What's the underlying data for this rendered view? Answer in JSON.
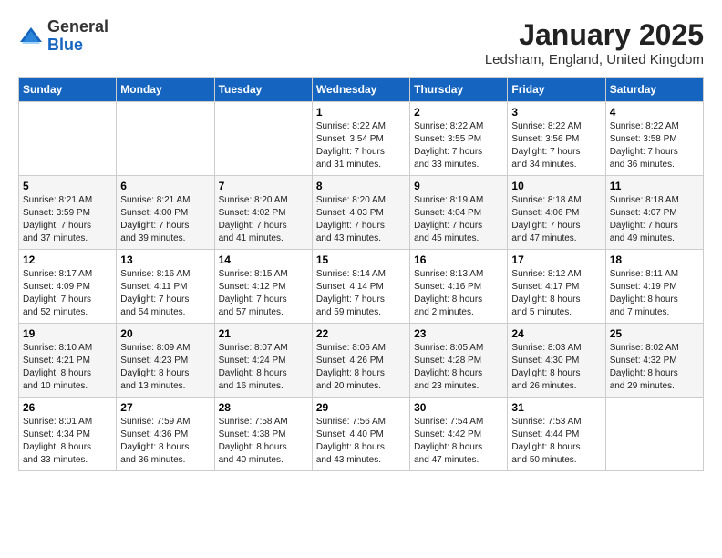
{
  "logo": {
    "general": "General",
    "blue": "Blue"
  },
  "header": {
    "title": "January 2025",
    "subtitle": "Ledsham, England, United Kingdom"
  },
  "weekdays": [
    "Sunday",
    "Monday",
    "Tuesday",
    "Wednesday",
    "Thursday",
    "Friday",
    "Saturday"
  ],
  "weeks": [
    [
      {
        "day": "",
        "info": ""
      },
      {
        "day": "",
        "info": ""
      },
      {
        "day": "",
        "info": ""
      },
      {
        "day": "1",
        "info": "Sunrise: 8:22 AM\nSunset: 3:54 PM\nDaylight: 7 hours\nand 31 minutes."
      },
      {
        "day": "2",
        "info": "Sunrise: 8:22 AM\nSunset: 3:55 PM\nDaylight: 7 hours\nand 33 minutes."
      },
      {
        "day": "3",
        "info": "Sunrise: 8:22 AM\nSunset: 3:56 PM\nDaylight: 7 hours\nand 34 minutes."
      },
      {
        "day": "4",
        "info": "Sunrise: 8:22 AM\nSunset: 3:58 PM\nDaylight: 7 hours\nand 36 minutes."
      }
    ],
    [
      {
        "day": "5",
        "info": "Sunrise: 8:21 AM\nSunset: 3:59 PM\nDaylight: 7 hours\nand 37 minutes."
      },
      {
        "day": "6",
        "info": "Sunrise: 8:21 AM\nSunset: 4:00 PM\nDaylight: 7 hours\nand 39 minutes."
      },
      {
        "day": "7",
        "info": "Sunrise: 8:20 AM\nSunset: 4:02 PM\nDaylight: 7 hours\nand 41 minutes."
      },
      {
        "day": "8",
        "info": "Sunrise: 8:20 AM\nSunset: 4:03 PM\nDaylight: 7 hours\nand 43 minutes."
      },
      {
        "day": "9",
        "info": "Sunrise: 8:19 AM\nSunset: 4:04 PM\nDaylight: 7 hours\nand 45 minutes."
      },
      {
        "day": "10",
        "info": "Sunrise: 8:18 AM\nSunset: 4:06 PM\nDaylight: 7 hours\nand 47 minutes."
      },
      {
        "day": "11",
        "info": "Sunrise: 8:18 AM\nSunset: 4:07 PM\nDaylight: 7 hours\nand 49 minutes."
      }
    ],
    [
      {
        "day": "12",
        "info": "Sunrise: 8:17 AM\nSunset: 4:09 PM\nDaylight: 7 hours\nand 52 minutes."
      },
      {
        "day": "13",
        "info": "Sunrise: 8:16 AM\nSunset: 4:11 PM\nDaylight: 7 hours\nand 54 minutes."
      },
      {
        "day": "14",
        "info": "Sunrise: 8:15 AM\nSunset: 4:12 PM\nDaylight: 7 hours\nand 57 minutes."
      },
      {
        "day": "15",
        "info": "Sunrise: 8:14 AM\nSunset: 4:14 PM\nDaylight: 7 hours\nand 59 minutes."
      },
      {
        "day": "16",
        "info": "Sunrise: 8:13 AM\nSunset: 4:16 PM\nDaylight: 8 hours\nand 2 minutes."
      },
      {
        "day": "17",
        "info": "Sunrise: 8:12 AM\nSunset: 4:17 PM\nDaylight: 8 hours\nand 5 minutes."
      },
      {
        "day": "18",
        "info": "Sunrise: 8:11 AM\nSunset: 4:19 PM\nDaylight: 8 hours\nand 7 minutes."
      }
    ],
    [
      {
        "day": "19",
        "info": "Sunrise: 8:10 AM\nSunset: 4:21 PM\nDaylight: 8 hours\nand 10 minutes."
      },
      {
        "day": "20",
        "info": "Sunrise: 8:09 AM\nSunset: 4:23 PM\nDaylight: 8 hours\nand 13 minutes."
      },
      {
        "day": "21",
        "info": "Sunrise: 8:07 AM\nSunset: 4:24 PM\nDaylight: 8 hours\nand 16 minutes."
      },
      {
        "day": "22",
        "info": "Sunrise: 8:06 AM\nSunset: 4:26 PM\nDaylight: 8 hours\nand 20 minutes."
      },
      {
        "day": "23",
        "info": "Sunrise: 8:05 AM\nSunset: 4:28 PM\nDaylight: 8 hours\nand 23 minutes."
      },
      {
        "day": "24",
        "info": "Sunrise: 8:03 AM\nSunset: 4:30 PM\nDaylight: 8 hours\nand 26 minutes."
      },
      {
        "day": "25",
        "info": "Sunrise: 8:02 AM\nSunset: 4:32 PM\nDaylight: 8 hours\nand 29 minutes."
      }
    ],
    [
      {
        "day": "26",
        "info": "Sunrise: 8:01 AM\nSunset: 4:34 PM\nDaylight: 8 hours\nand 33 minutes."
      },
      {
        "day": "27",
        "info": "Sunrise: 7:59 AM\nSunset: 4:36 PM\nDaylight: 8 hours\nand 36 minutes."
      },
      {
        "day": "28",
        "info": "Sunrise: 7:58 AM\nSunset: 4:38 PM\nDaylight: 8 hours\nand 40 minutes."
      },
      {
        "day": "29",
        "info": "Sunrise: 7:56 AM\nSunset: 4:40 PM\nDaylight: 8 hours\nand 43 minutes."
      },
      {
        "day": "30",
        "info": "Sunrise: 7:54 AM\nSunset: 4:42 PM\nDaylight: 8 hours\nand 47 minutes."
      },
      {
        "day": "31",
        "info": "Sunrise: 7:53 AM\nSunset: 4:44 PM\nDaylight: 8 hours\nand 50 minutes."
      },
      {
        "day": "",
        "info": ""
      }
    ]
  ]
}
